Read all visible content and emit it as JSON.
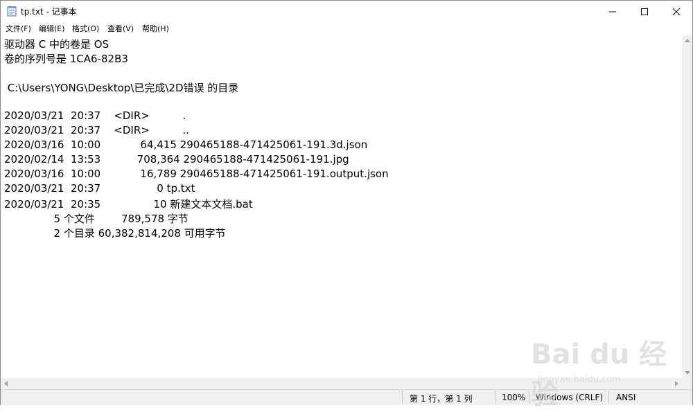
{
  "window": {
    "title": "tp.txt - 记事本",
    "icon": "notepad-icon",
    "controls": [
      "minimize-icon",
      "maximize-icon",
      "close-icon"
    ]
  },
  "menu": [
    {
      "label": "文件(F)"
    },
    {
      "label": "编辑(E)"
    },
    {
      "label": "格式(O)"
    },
    {
      "label": "查看(V)"
    },
    {
      "label": "帮助(H)"
    }
  ],
  "editor": {
    "lines": [
      "驱动器 C 中的卷是 OS",
      "卷的序列号是 1CA6-82B3",
      "",
      " C:\\Users\\YONG\\Desktop\\已完成\\2D错误 的目录",
      "",
      "2020/03/21  20:37    <DIR>          .",
      "2020/03/21  20:37    <DIR>          ..",
      "2020/03/16  10:00            64,415 290465188-471425061-191.3d.json",
      "2020/02/14  13:53           708,364 290465188-471425061-191.jpg",
      "2020/03/16  10:00            16,789 290465188-471425061-191.output.json",
      "2020/03/21  20:37                 0 tp.txt",
      "2020/03/21  20:35                10 新建文本文档.bat",
      "               5 个文件        789,578 字节",
      "               2 个目录 60,382,814,208 可用字节"
    ]
  },
  "statusbar": {
    "position": "第 1 行，第 1 列",
    "zoom": "100%",
    "line_ending": "Windows (CRLF)",
    "encoding": "ANSI"
  },
  "watermark": {
    "brand": "Bai du 经验",
    "url": "jingyan.baidu.com"
  }
}
